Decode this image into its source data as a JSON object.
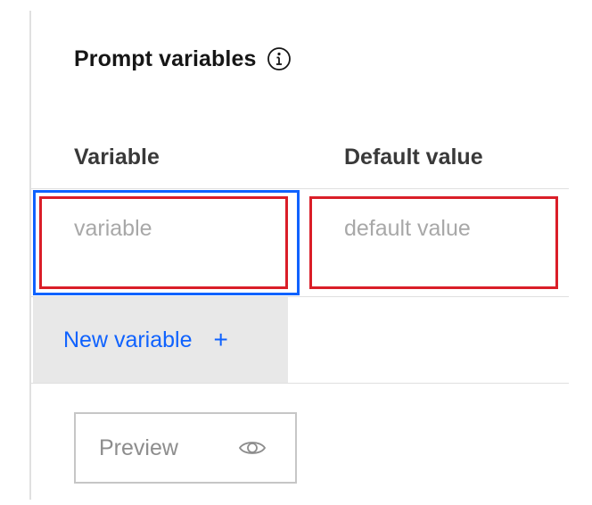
{
  "section": {
    "title": "Prompt variables",
    "info_icon": "info-icon"
  },
  "table": {
    "headers": [
      "Variable",
      "Default value"
    ],
    "row": {
      "variable_value": "",
      "variable_placeholder": "variable",
      "default_value": "",
      "default_placeholder": "default value"
    }
  },
  "actions": {
    "new_variable_label": "New variable",
    "new_variable_icon": "+",
    "preview_label": "Preview",
    "preview_icon": "eye-icon"
  },
  "colors": {
    "link": "#0f62fe",
    "focus": "#0f62fe",
    "error": "#da1e28"
  }
}
